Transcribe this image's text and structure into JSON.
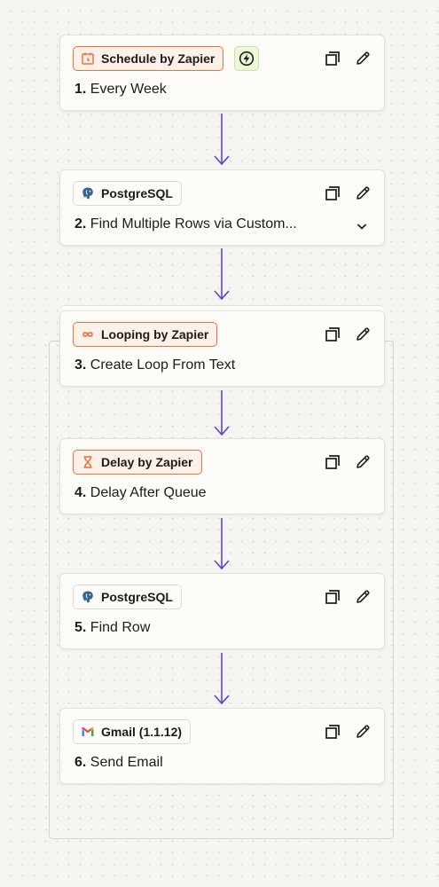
{
  "colors": {
    "accent": "#5b45d6",
    "zapier_orange": "#e8743b",
    "trigger_green": "#cbe39f"
  },
  "steps": [
    {
      "app": "Schedule by Zapier",
      "app_icon": "calendar-icon",
      "number": "1.",
      "title": "Every Week",
      "trigger_badge_icon": "lightning-icon"
    },
    {
      "app": "PostgreSQL",
      "app_icon": "postgresql-icon",
      "number": "2.",
      "title": "Find Multiple Rows via Custom...",
      "expand_icon": "chevron-down-icon"
    },
    {
      "app": "Looping by Zapier",
      "app_icon": "infinity-loop-icon",
      "number": "3.",
      "title": "Create Loop From Text"
    },
    {
      "app": "Delay by Zapier",
      "app_icon": "hourglass-icon",
      "number": "4.",
      "title": "Delay After Queue"
    },
    {
      "app": "PostgreSQL",
      "app_icon": "postgresql-icon",
      "number": "5.",
      "title": "Find Row"
    },
    {
      "app": "Gmail (1.1.12)",
      "app_icon": "gmail-icon",
      "number": "6.",
      "title": "Send Email"
    }
  ],
  "step_actions": {
    "copy_icon": "copy-icon",
    "edit_icon": "pencil-icon"
  }
}
